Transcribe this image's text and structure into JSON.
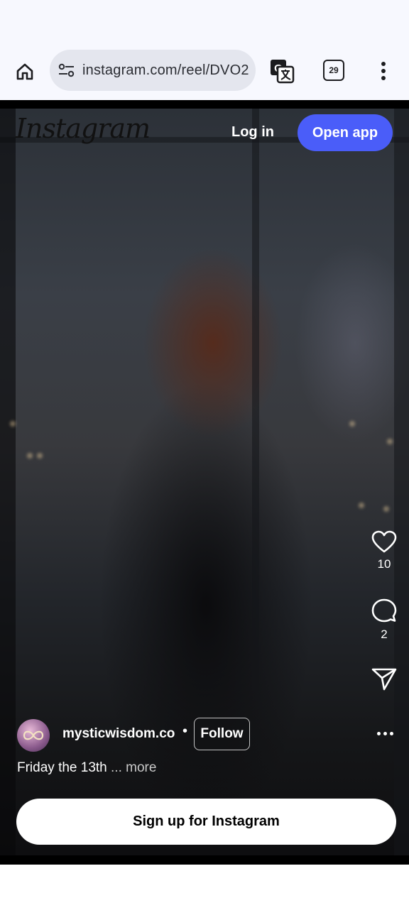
{
  "browser": {
    "url": "instagram.com/reel/DVO2",
    "tab_count": "29",
    "icons": {
      "home": "home-icon",
      "site_settings": "tune-icon",
      "translate": "translate-icon",
      "tabs": "tabs-icon",
      "menu": "more-vert-icon"
    }
  },
  "header": {
    "logo": "Instagram",
    "login_label": "Log in",
    "open_app_label": "Open app"
  },
  "actions": {
    "likes": "10",
    "comments": "2",
    "icons": [
      "heart-icon",
      "comment-icon",
      "share-icon"
    ]
  },
  "post": {
    "username": "mysticwisdom.co",
    "separator": "•",
    "follow_label": "Follow",
    "caption": "Friday the 13th",
    "more_label": "... more"
  },
  "signup_label": "Sign up for Instagram",
  "colors": {
    "accent": "#4a5df9",
    "toolbar_bg": "#f7f8fe",
    "urlbar_bg": "#e4e6ee"
  }
}
